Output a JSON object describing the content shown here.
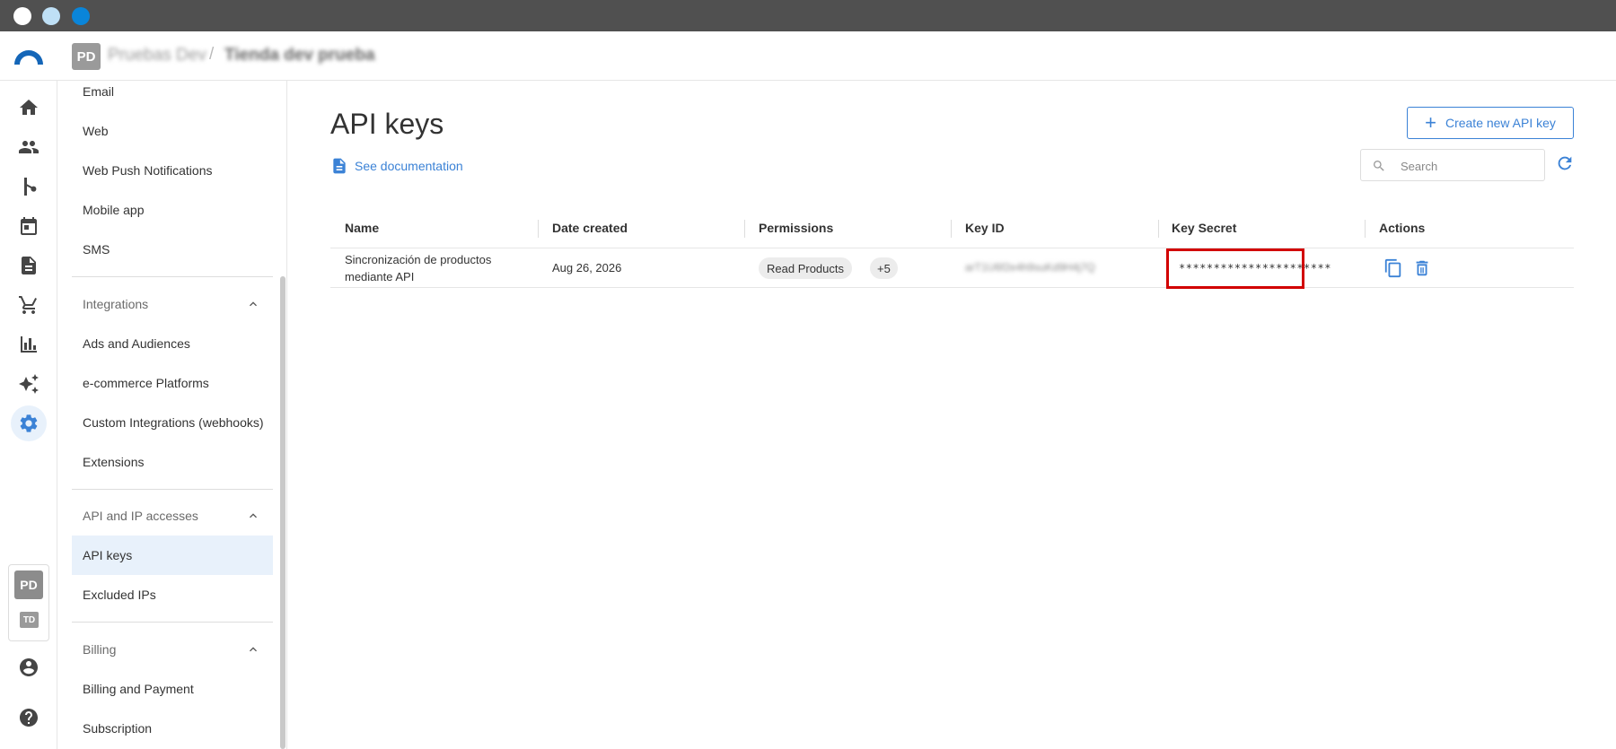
{
  "window": {
    "controls": [
      "close",
      "minimize",
      "maximize"
    ]
  },
  "header": {
    "org_initials": "PD",
    "org_name": "Pruebas Dev",
    "separator": "/",
    "store_name": "Tienda dev prueba"
  },
  "rail": {
    "icons": [
      "home-icon",
      "users-icon",
      "flow-icon",
      "calendar-icon",
      "document-icon",
      "cart-icon",
      "chart-icon",
      "sparkle-icon",
      "gear-icon"
    ],
    "active": "gear-icon",
    "accounts": [
      "PD",
      "TD"
    ],
    "bottom_icons": [
      "account-icon",
      "help-icon"
    ]
  },
  "settings_nav": {
    "channel_items": [
      "Email",
      "Web",
      "Web Push Notifications",
      "Mobile app",
      "SMS"
    ],
    "integrations": {
      "label": "Integrations",
      "items": [
        "Ads and Audiences",
        "e-commerce Platforms",
        "Custom Integrations (webhooks)",
        "Extensions"
      ]
    },
    "api_access": {
      "label": "API and IP accesses",
      "items": [
        "API keys",
        "Excluded IPs"
      ],
      "active": "API keys"
    },
    "billing": {
      "label": "Billing",
      "items": [
        "Billing and Payment",
        "Subscription"
      ]
    }
  },
  "main": {
    "title": "API keys",
    "doc_link": "See documentation",
    "create_button": "Create new API key",
    "search_placeholder": "Search",
    "table": {
      "columns": [
        "Name",
        "Date created",
        "Permissions",
        "Key ID",
        "Key Secret",
        "Actions"
      ],
      "rows": [
        {
          "name": "Sincronización de productos mediante API",
          "date_created": "Aug 26, 2026",
          "permission": "Read Products",
          "more_permissions": "+5",
          "key_id": "arT1U6f2e4h9suKd9H4j7Q",
          "key_secret": "**********************"
        }
      ]
    }
  },
  "colors": {
    "accent": "#3b82d6",
    "highlight_border": "#d20000",
    "active_bg": "#e8f1fb"
  }
}
